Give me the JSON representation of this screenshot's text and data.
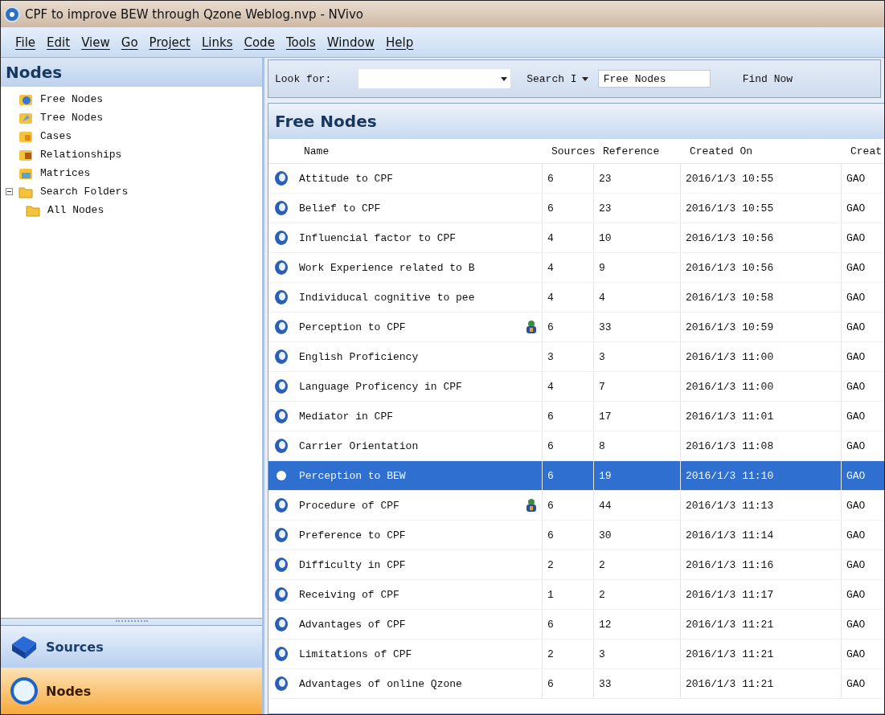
{
  "window": {
    "title": "CPF to improve BEW through Qzone Weblog.nvp - NVivo"
  },
  "menu": [
    {
      "label": "File"
    },
    {
      "label": "Edit"
    },
    {
      "label": "View"
    },
    {
      "label": "Go"
    },
    {
      "label": "Project"
    },
    {
      "label": "Links"
    },
    {
      "label": "Code"
    },
    {
      "label": "Tools"
    },
    {
      "label": "Window"
    },
    {
      "label": "Help"
    }
  ],
  "sidebar": {
    "title": "Nodes",
    "items": [
      {
        "label": "Free Nodes",
        "selected": false
      },
      {
        "label": "Tree Nodes",
        "selected": false
      },
      {
        "label": "Cases",
        "selected": false
      },
      {
        "label": "Relationships",
        "selected": false
      },
      {
        "label": "Matrices",
        "selected": false
      },
      {
        "label": "Search Folders",
        "expanded": true,
        "selected": false,
        "children": [
          {
            "label": "All Nodes",
            "selected": false
          }
        ]
      }
    ]
  },
  "navigation": [
    {
      "label": "Sources",
      "kind": "sources",
      "selected": false
    },
    {
      "label": "Nodes",
      "kind": "nodes",
      "selected": true
    }
  ],
  "search": {
    "look_for_label": "Look for:",
    "search_in_label": "Search I",
    "search_in_value": "Free Nodes",
    "find_button": "Find Now"
  },
  "table": {
    "title": "Free Nodes",
    "columns": [
      "Name",
      "Sources",
      "Reference",
      "Created On",
      "Creat"
    ],
    "rows": [
      {
        "cells": [
          "Attitude to CPF",
          "6",
          "23",
          "2016/1/3 10:55",
          "GAO"
        ],
        "linked": false,
        "selected": false
      },
      {
        "cells": [
          "Belief to CPF",
          "6",
          "23",
          "2016/1/3 10:55",
          "GAO"
        ],
        "linked": false,
        "selected": false
      },
      {
        "cells": [
          "Influencial factor to CPF",
          "4",
          "10",
          "2016/1/3 10:56",
          "GAO"
        ],
        "linked": false,
        "selected": false
      },
      {
        "cells": [
          "Work Experience related to B",
          "4",
          "9",
          "2016/1/3 10:56",
          "GAO"
        ],
        "linked": false,
        "selected": false
      },
      {
        "cells": [
          "Individucal cognitive to pee",
          "4",
          "4",
          "2016/1/3 10:58",
          "GAO"
        ],
        "linked": false,
        "selected": false
      },
      {
        "cells": [
          "Perception to CPF",
          "6",
          "33",
          "2016/1/3 10:59",
          "GAO"
        ],
        "linked": true,
        "selected": false
      },
      {
        "cells": [
          "English Proficiency",
          "3",
          "3",
          "2016/1/3 11:00",
          "GAO"
        ],
        "linked": false,
        "selected": false
      },
      {
        "cells": [
          "Language Proficency in CPF",
          "4",
          "7",
          "2016/1/3 11:00",
          "GAO"
        ],
        "linked": false,
        "selected": false
      },
      {
        "cells": [
          "Mediator in CPF",
          "6",
          "17",
          "2016/1/3 11:01",
          "GAO"
        ],
        "linked": false,
        "selected": false
      },
      {
        "cells": [
          "Carrier Orientation",
          "6",
          "8",
          "2016/1/3 11:08",
          "GAO"
        ],
        "linked": false,
        "selected": false
      },
      {
        "cells": [
          "Perception to BEW",
          "6",
          "19",
          "2016/1/3 11:10",
          "GAO"
        ],
        "linked": false,
        "selected": true
      },
      {
        "cells": [
          "Procedure of CPF",
          "6",
          "44",
          "2016/1/3 11:13",
          "GAO"
        ],
        "linked": true,
        "selected": false
      },
      {
        "cells": [
          "Preference to CPF",
          "6",
          "30",
          "2016/1/3 11:14",
          "GAO"
        ],
        "linked": false,
        "selected": false
      },
      {
        "cells": [
          "Difficulty in CPF",
          "2",
          "2",
          "2016/1/3 11:16",
          "GAO"
        ],
        "linked": false,
        "selected": false
      },
      {
        "cells": [
          "Receiving of CPF",
          "1",
          "2",
          "2016/1/3 11:17",
          "GAO"
        ],
        "linked": false,
        "selected": false
      },
      {
        "cells": [
          "Advantages of CPF",
          "6",
          "12",
          "2016/1/3 11:21",
          "GAO"
        ],
        "linked": false,
        "selected": false
      },
      {
        "cells": [
          "Limitations of CPF",
          "2",
          "3",
          "2016/1/3 11:21",
          "GAO"
        ],
        "linked": false,
        "selected": false
      },
      {
        "cells": [
          "Advantages of online Qzone",
          "6",
          "33",
          "2016/1/3 11:21",
          "GAO"
        ],
        "linked": false,
        "selected": false
      }
    ]
  }
}
